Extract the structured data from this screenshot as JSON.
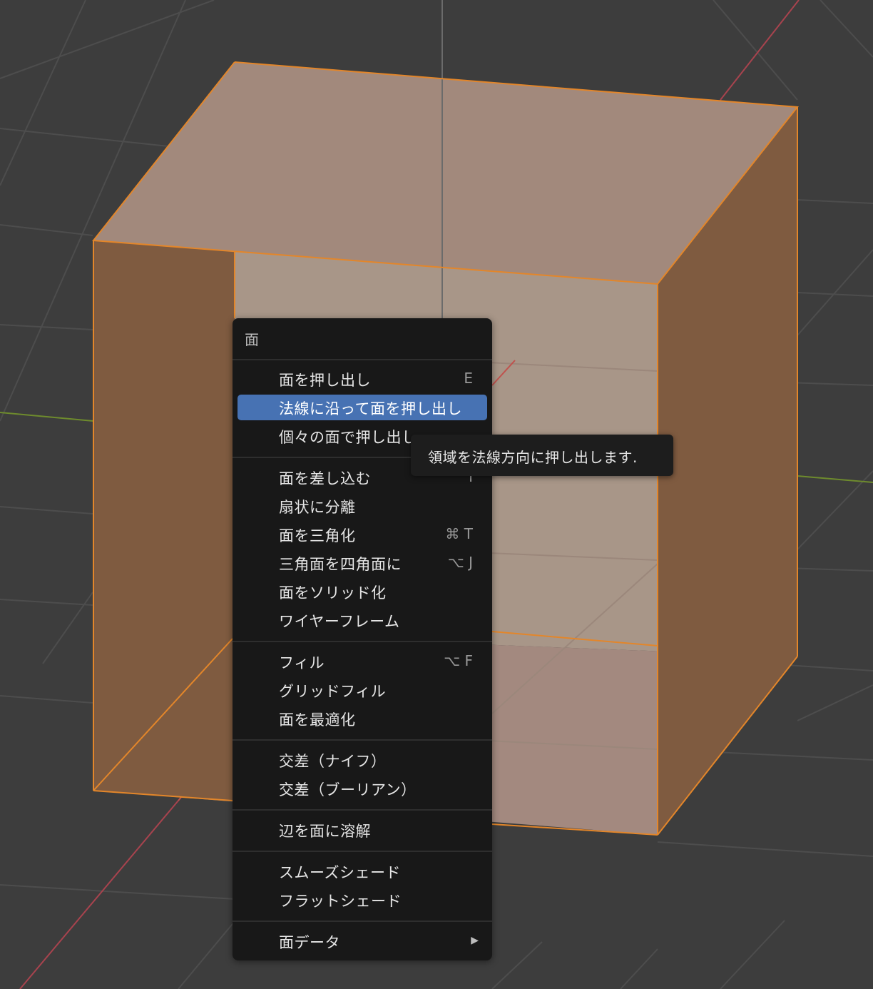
{
  "viewport": {
    "colors": {
      "background": "#3d3d3d",
      "grid": "#4d4d4d",
      "x_axis": "#a8434e",
      "y_axis": "#6e8b2d",
      "selection_edge": "#e3862a",
      "face_top": "#a2897c",
      "face_side": "#7f5b40",
      "face_inner": "#a89688"
    }
  },
  "menu": {
    "title": "面",
    "items": [
      {
        "label": "面を押し出し",
        "shortcut": "E"
      },
      {
        "label": "法線に沿って面を押し出し",
        "shortcut": "",
        "highlighted": true
      },
      {
        "label": "個々の面で押し出し",
        "shortcut": ""
      },
      {
        "label": "面を差し込む",
        "shortcut": "I"
      },
      {
        "label": "扇状に分離",
        "shortcut": ""
      },
      {
        "label": "面を三角化",
        "shortcut": "⌘ T"
      },
      {
        "label": "三角面を四角面に",
        "shortcut": "⌥ J"
      },
      {
        "label": "面をソリッド化",
        "shortcut": ""
      },
      {
        "label": "ワイヤーフレーム",
        "shortcut": ""
      },
      {
        "label": "フィル",
        "shortcut": "⌥ F"
      },
      {
        "label": "グリッドフィル",
        "shortcut": ""
      },
      {
        "label": "面を最適化",
        "shortcut": ""
      },
      {
        "label": "交差（ナイフ）",
        "shortcut": ""
      },
      {
        "label": "交差（ブーリアン）",
        "shortcut": ""
      },
      {
        "label": "辺を面に溶解",
        "shortcut": ""
      },
      {
        "label": "スムーズシェード",
        "shortcut": ""
      },
      {
        "label": "フラットシェード",
        "shortcut": ""
      },
      {
        "label": "面データ",
        "shortcut": "",
        "submenu_icon": "submenu-arrow-icon"
      }
    ]
  },
  "tooltip": {
    "text": "領域を法線方向に押し出します."
  }
}
